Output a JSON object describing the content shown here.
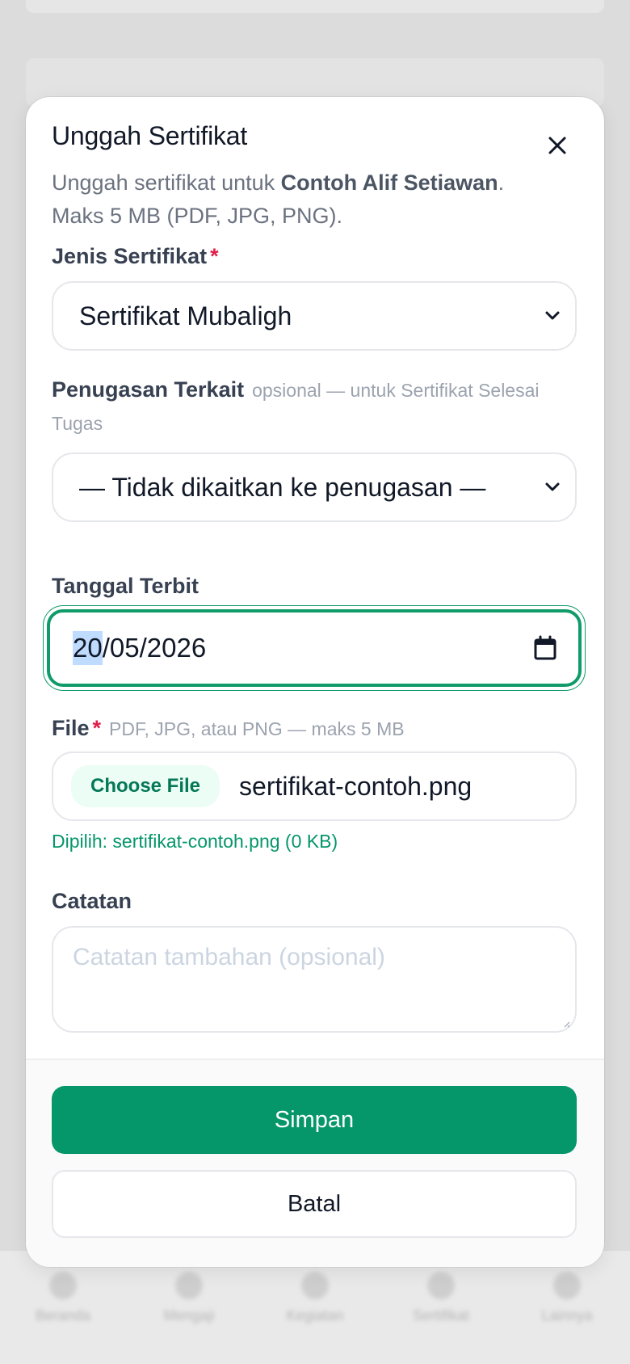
{
  "background_nav": {
    "items": [
      {
        "label": "Beranda"
      },
      {
        "label": "Mengaji"
      },
      {
        "label": "Kegiatan"
      },
      {
        "label": "Sertifikat"
      },
      {
        "label": "Lainnya"
      }
    ]
  },
  "modal": {
    "title": "Unggah Sertifikat",
    "description_prefix": "Unggah sertifikat untuk ",
    "description_name": "Contoh Alif Setiawan",
    "description_suffix": ".",
    "description_line2": "Maks 5 MB (PDF, JPG, PNG)."
  },
  "fields": {
    "jenis": {
      "label": "Jenis Sertifikat",
      "required_mark": "*",
      "selected": "Sertifikat Mubaligh"
    },
    "penugasan": {
      "label": "Penugasan Terkait",
      "hint": "opsional — untuk Sertifikat Selesai Tugas",
      "selected": "— Tidak dikaitkan ke penugasan —"
    },
    "tanggal": {
      "label": "Tanggal Terbit",
      "day": "20",
      "rest": "/05/2026"
    },
    "file": {
      "label": "File",
      "required_mark": "*",
      "hint": "PDF, JPG, atau PNG — maks 5 MB",
      "choose_label": "Choose File",
      "file_name": "sertifikat-contoh.png",
      "selected_info": "Dipilih: sertifikat-contoh.png (0 KB)"
    },
    "catatan": {
      "label": "Catatan",
      "placeholder": "Catatan tambahan (opsional)"
    }
  },
  "actions": {
    "save_label": "Simpan",
    "cancel_label": "Batal"
  },
  "colors": {
    "accent": "#059669",
    "required": "#e11d48",
    "focus_ring": "#0f9b6a"
  }
}
